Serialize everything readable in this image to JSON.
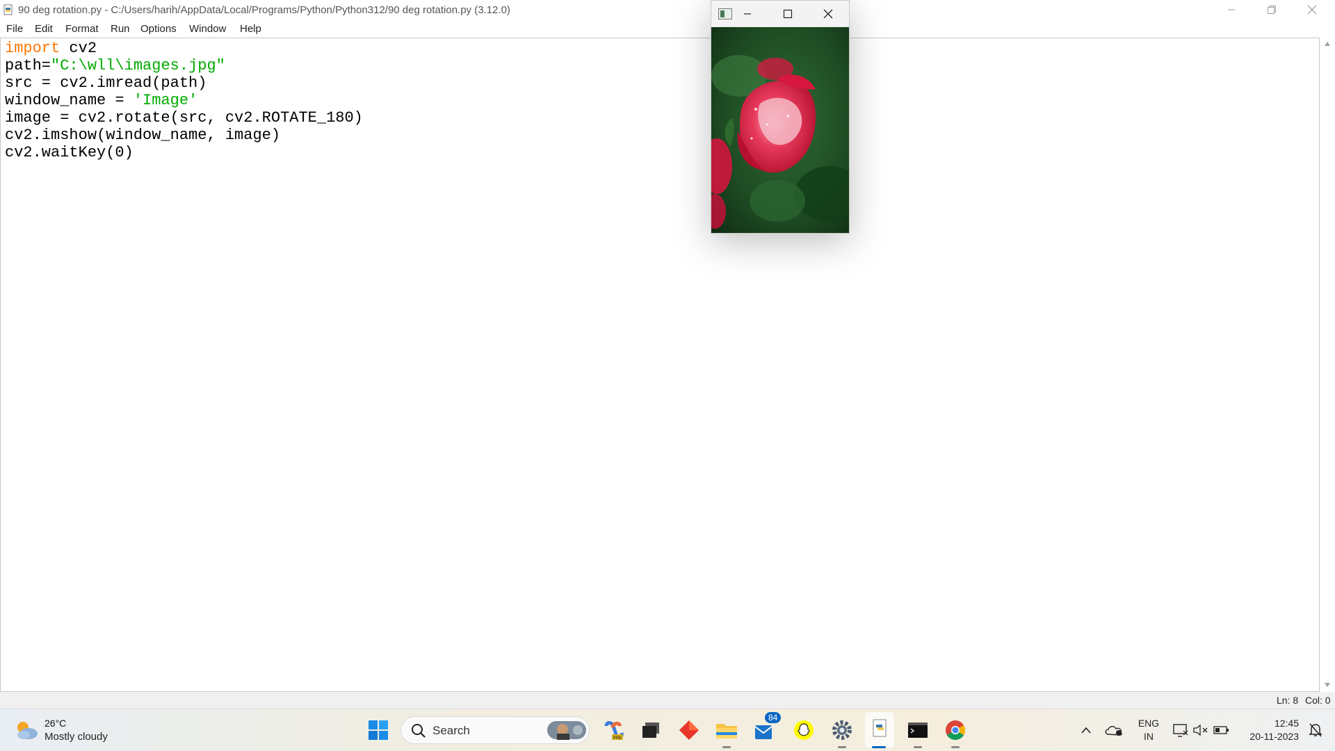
{
  "window": {
    "title": "90 deg rotation.py - C:/Users/harih/AppData/Local/Programs/Python/Python312/90 deg rotation.py (3.12.0)"
  },
  "menu": [
    "File",
    "Edit",
    "Format",
    "Run",
    "Options",
    "Window",
    "Help"
  ],
  "code": {
    "lines": [
      [
        {
          "t": "import",
          "c": "kw"
        },
        {
          "t": " cv2",
          "c": ""
        }
      ],
      [
        {
          "t": "path=",
          "c": ""
        },
        {
          "t": "\"C:\\wll\\images.jpg\"",
          "c": "str"
        }
      ],
      [
        {
          "t": "src = cv2.imread(path)",
          "c": ""
        }
      ],
      [
        {
          "t": "window_name = ",
          "c": ""
        },
        {
          "t": "'Image'",
          "c": "str"
        }
      ],
      [
        {
          "t": "image = cv2.rotate(src, cv2.ROTATE_180)",
          "c": ""
        }
      ],
      [
        {
          "t": "cv2.imshow(window_name, image)",
          "c": ""
        }
      ],
      [
        {
          "t": "cv2.waitKey(0)",
          "c": ""
        }
      ]
    ]
  },
  "status": {
    "line": "Ln: 8",
    "col": "Col: 0"
  },
  "taskbar": {
    "weather_temp": "26°C",
    "weather_desc": "Mostly cloudy",
    "search_placeholder": "Search",
    "mail_badge": "84",
    "language": "ENG",
    "region": "IN",
    "time": "12:45",
    "date": "20-11-2023"
  },
  "colors": {
    "keyword": "#ff7700",
    "string": "#00aa00",
    "accent": "#0067c0"
  }
}
